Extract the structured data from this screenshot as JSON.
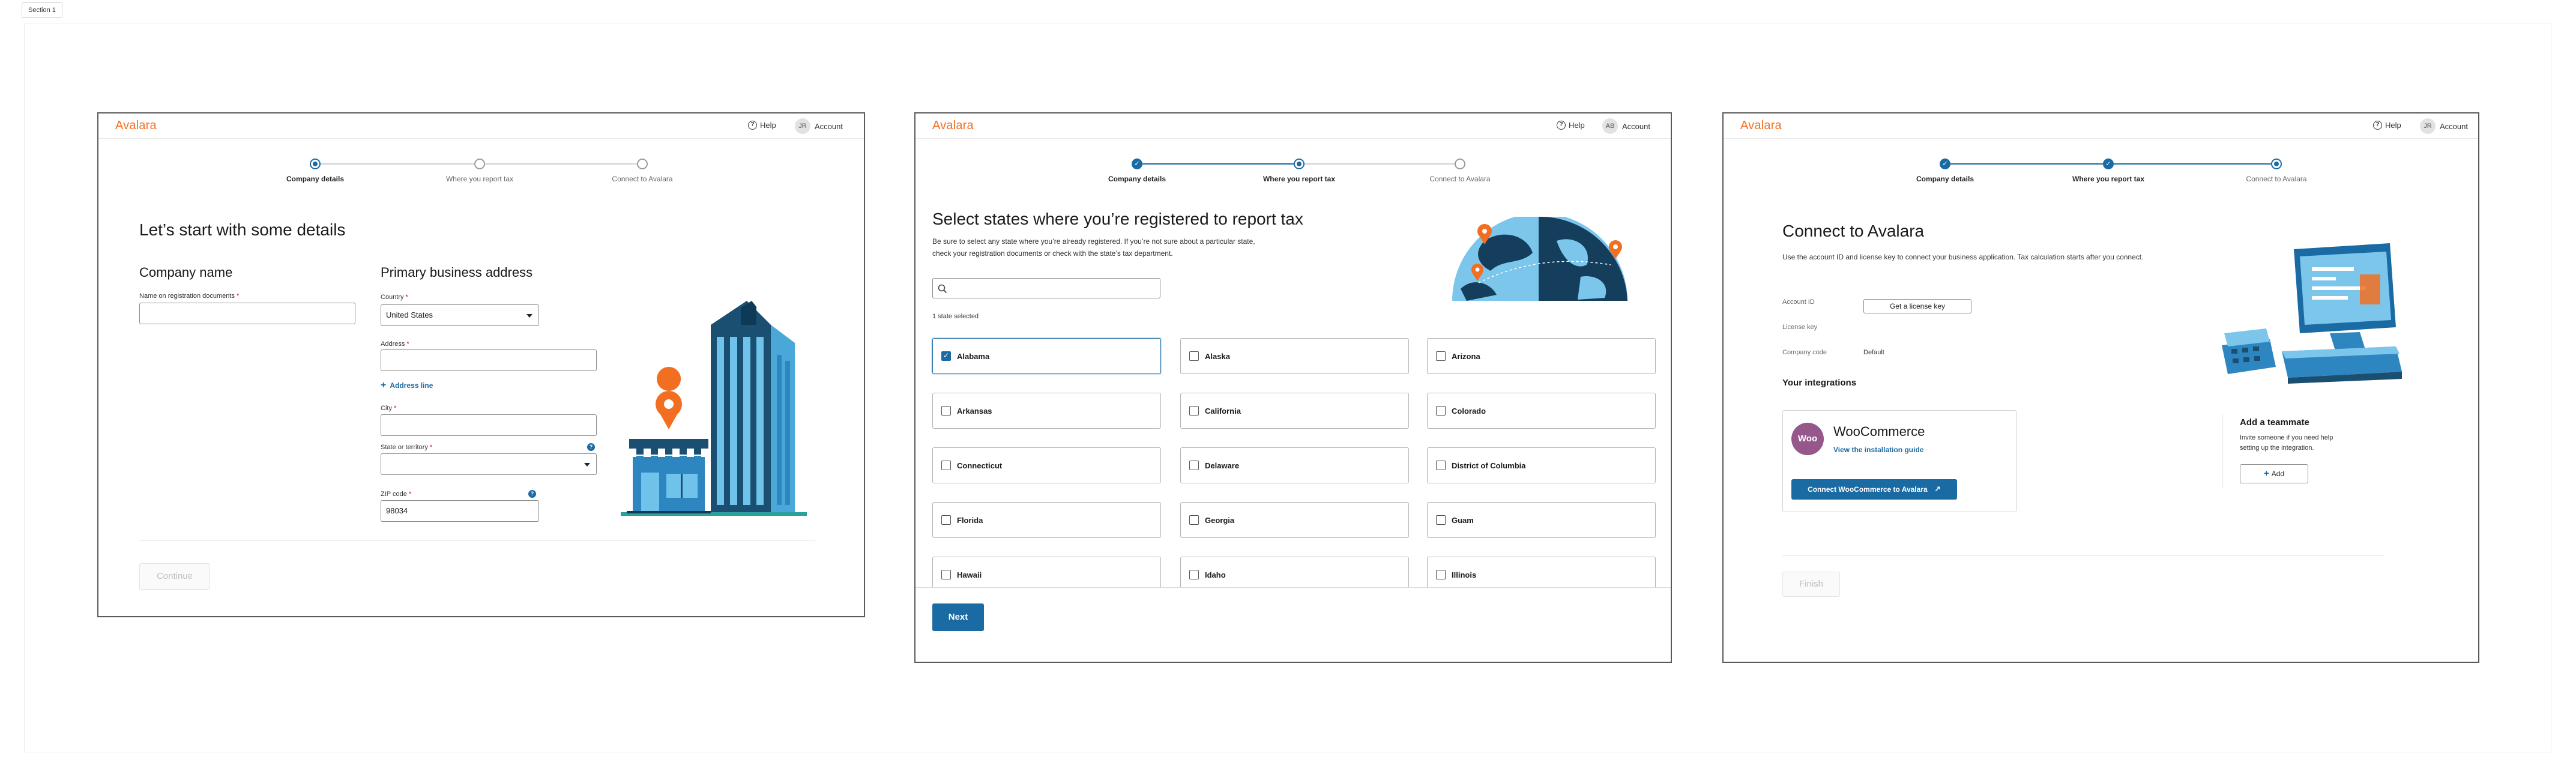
{
  "section_label": "Section 1",
  "brand": {
    "logo": "Avalara",
    "accent": "#f26e21",
    "primary": "#1a6aa3"
  },
  "screen1": {
    "header": {
      "help": "Help",
      "avatar": "JR",
      "account": "Account"
    },
    "steps": [
      "Company details",
      "Where you report tax",
      "Connect to Avalara"
    ],
    "title": "Let’s start with some details",
    "company": {
      "heading": "Company name",
      "name_label": "Name on registration documents",
      "name_value": ""
    },
    "address": {
      "heading": "Primary business address",
      "country_label": "Country",
      "country_value": "United States",
      "address_label": "Address",
      "add_line": "Address line",
      "city_label": "City",
      "state_label": "State or territory",
      "state_value": "",
      "zip_label": "ZIP code",
      "zip_value": "98034"
    },
    "continue": "Continue"
  },
  "screen2": {
    "header": {
      "help": "Help",
      "avatar": "AB",
      "account": "Account"
    },
    "steps": [
      "Company details",
      "Where you report tax",
      "Connect to Avalara"
    ],
    "title": "Select states where you’re registered to report tax",
    "desc_line1": "Be sure to select any state where you’re already registered. If you’re not sure about a particular state,",
    "desc_line2": "check your registration documents or check with the state’s tax department.",
    "search_placeholder": "",
    "selected_count": "1 state selected",
    "states": [
      {
        "name": "Alabama",
        "checked": true
      },
      {
        "name": "Alaska",
        "checked": false
      },
      {
        "name": "Arizona",
        "checked": false
      },
      {
        "name": "Arkansas",
        "checked": false
      },
      {
        "name": "California",
        "checked": false
      },
      {
        "name": "Colorado",
        "checked": false
      },
      {
        "name": "Connecticut",
        "checked": false
      },
      {
        "name": "Delaware",
        "checked": false
      },
      {
        "name": "District of Columbia",
        "checked": false
      },
      {
        "name": "Florida",
        "checked": false
      },
      {
        "name": "Georgia",
        "checked": false
      },
      {
        "name": "Guam",
        "checked": false
      },
      {
        "name": "Hawaii",
        "checked": false
      },
      {
        "name": "Idaho",
        "checked": false
      },
      {
        "name": "Illinois",
        "checked": false
      }
    ],
    "next": "Next"
  },
  "screen3": {
    "header": {
      "help": "Help",
      "avatar": "JR",
      "account": "Account"
    },
    "steps": [
      "Company details",
      "Where you report tax",
      "Connect to Avalara"
    ],
    "title": "Connect to Avalara",
    "desc": "Use the account ID and license key to connect your business application. Tax calculation starts after you connect.",
    "account_id_label": "Account ID",
    "license_button": "Get a license key",
    "license_key_label": "License key",
    "company_code_label": "Company code",
    "company_code_value": "Default",
    "integrations_heading": "Your integrations",
    "integration": {
      "logo": "Woo",
      "name": "WooCommerce",
      "guide_link": "View the installation guide",
      "connect_button": "Connect WooCommerce to Avalara",
      "brand_color": "#96588a"
    },
    "teammate": {
      "heading": "Add a teammate",
      "desc_line1": "Invite someone if you need help",
      "desc_line2": "setting up the integration.",
      "add_button": "Add"
    },
    "finish": "Finish"
  }
}
